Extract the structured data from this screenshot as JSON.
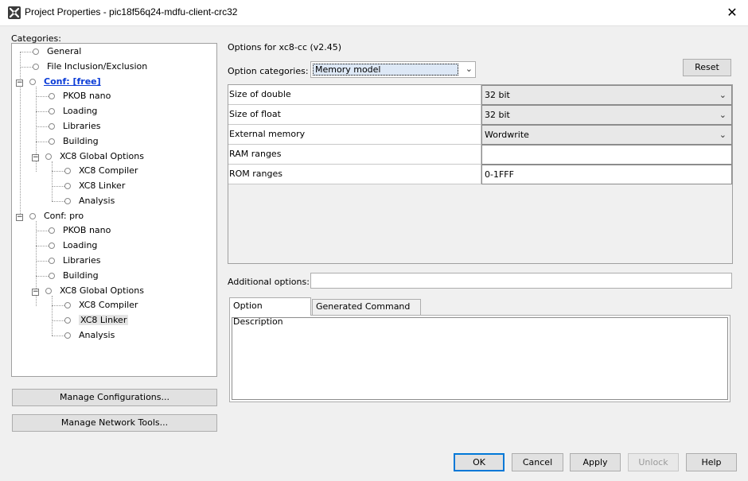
{
  "window": {
    "title": "Project Properties - pic18f56q24-mdfu-client-crc32",
    "close_glyph": "✕"
  },
  "categories": {
    "label": "Categories:",
    "tree": [
      {
        "label": "General"
      },
      {
        "label": "File Inclusion/Exclusion"
      },
      {
        "label": "Conf: [free]"
      },
      {
        "label": "PKOB nano"
      },
      {
        "label": "Loading"
      },
      {
        "label": "Libraries"
      },
      {
        "label": "Building"
      },
      {
        "label": "XC8 Global Options"
      },
      {
        "label": "XC8 Compiler"
      },
      {
        "label": "XC8 Linker"
      },
      {
        "label": "Analysis"
      },
      {
        "label": "Conf: pro"
      },
      {
        "label": "PKOB nano"
      },
      {
        "label": "Loading"
      },
      {
        "label": "Libraries"
      },
      {
        "label": "Building"
      },
      {
        "label": "XC8 Global Options"
      },
      {
        "label": "XC8 Compiler"
      },
      {
        "label": "XC8 Linker"
      },
      {
        "label": "Analysis"
      }
    ],
    "collapse_glyph": "−"
  },
  "left_buttons": {
    "manage_configurations": "Manage Configurations...",
    "manage_network_tools": "Manage Network Tools..."
  },
  "options": {
    "title": "Options for xc8-cc (v2.45)",
    "category_label": "Option categories:",
    "category_value": "Memory model",
    "reset_label": "Reset",
    "properties": [
      {
        "name": "Size of double",
        "value": "32 bit",
        "kind": "combo"
      },
      {
        "name": "Size of float",
        "value": "32 bit",
        "kind": "combo"
      },
      {
        "name": "External memory",
        "value": "Wordwrite",
        "kind": "combo"
      },
      {
        "name": "RAM ranges",
        "value": "",
        "kind": "text"
      },
      {
        "name": "ROM ranges",
        "value": "0-1FFF",
        "kind": "text"
      }
    ],
    "additional_label": "Additional options:",
    "additional_value": "",
    "tabs": [
      {
        "label": "Option Description"
      },
      {
        "label": "Generated Command Line"
      }
    ]
  },
  "dialog_buttons": {
    "ok": "OK",
    "cancel": "Cancel",
    "apply": "Apply",
    "unlock": "Unlock",
    "help": "Help"
  },
  "colors": {
    "active_conf": "#0b3cd7",
    "dialog_bg": "#f0f0f0",
    "ok_border": "#0078d7"
  }
}
